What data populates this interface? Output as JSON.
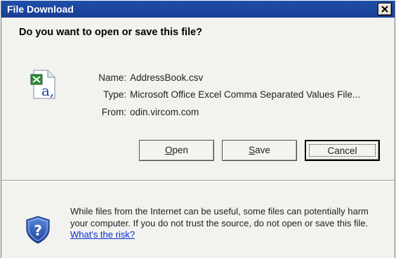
{
  "window": {
    "title": "File Download"
  },
  "prompt": "Do you want to open or save this file?",
  "file": {
    "name_label": "Name:",
    "name_value": "AddressBook.csv",
    "type_label": "Type:",
    "type_value": "Microsoft Office Excel Comma Separated Values File...",
    "from_label": "From:",
    "from_value": "odin.vircom.com",
    "icon": "excel-file-icon"
  },
  "buttons": {
    "open_rest": "pen",
    "open_mnemonic": "O",
    "save_rest": "ave",
    "save_mnemonic": "S",
    "cancel": "Cancel"
  },
  "warning": {
    "text": "While files from the Internet can be useful, some files can potentially harm your computer. If you do not trust the source, do not open or save this file.",
    "link": "What's the risk?",
    "icon": "shield-question-icon"
  },
  "colors": {
    "titlebar": "#1e4fa8",
    "link": "#0a2fd0",
    "dialog_bg": "#f2f2ef"
  }
}
